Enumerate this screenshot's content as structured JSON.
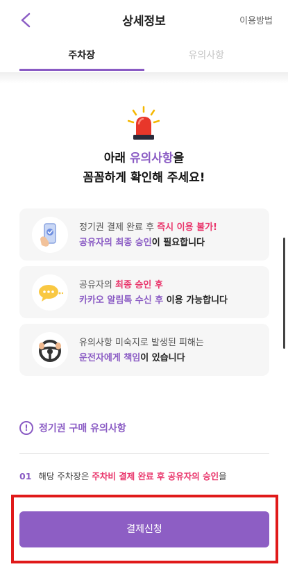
{
  "header": {
    "back_icon": "chevron-left-icon",
    "title": "상세정보",
    "howto_label": "이용방법"
  },
  "tabs": [
    {
      "label": "주차장",
      "active": true
    },
    {
      "label": "유의사항",
      "active": false
    }
  ],
  "hero": {
    "icon": "siren-icon",
    "line1_pre": "아래 ",
    "line1_accent": "유의사항",
    "line1_post": "을",
    "line2": "꼼꼼하게 확인해 주세요!"
  },
  "cards": [
    {
      "icon": "phone-check-icon",
      "line1_pre": "정기권 결제 완료 후 ",
      "line1_accent": "즉시 이용 불가!",
      "line2_accent": "공유자의 최종 승인",
      "line2_post": "이 필요합니다"
    },
    {
      "icon": "chat-bubble-icon",
      "line1_pre": "공유자의 ",
      "line1_accent": "최종 승인 후",
      "line2_accent": "카카오 알림톡 수신 후",
      "line2_post": " 이용 가능합니다"
    },
    {
      "icon": "steering-wheel-icon",
      "line1_pre": "유의사항 미숙지로 발생된 피해는",
      "line1_accent": "",
      "line2_accent": "운전자에게 책임",
      "line2_post": "이 있습니다"
    }
  ],
  "notice": {
    "icon": "exclamation-circle-icon",
    "title": "정기권 구매 유의사항",
    "item": {
      "num": "01",
      "pre": "해당 주차장은 ",
      "accent": "주차비 결제 완료 후 공유자의 승인",
      "post": "을"
    }
  },
  "pay_button": {
    "label": "결제신청"
  },
  "colors": {
    "accent": "#8a5bc4",
    "highlight": "#e9356b",
    "button": "#8d5ec4",
    "outline": "#e01919"
  }
}
